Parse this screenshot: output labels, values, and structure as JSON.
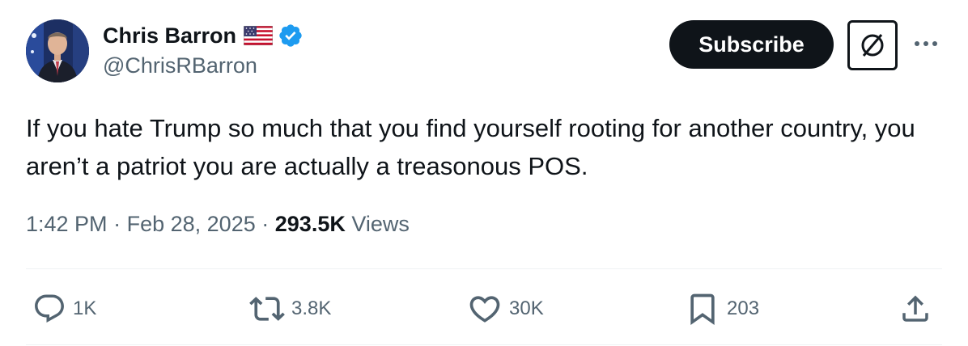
{
  "author": {
    "display_name": "Chris Barron",
    "handle": "@ChrisRBarron",
    "verified": true,
    "avatar_icon": "avatar-photo",
    "flag_icon": "us-flag-icon"
  },
  "header": {
    "subscribe_label": "Subscribe",
    "grok_icon": "grok-icon",
    "more_icon": "more-dots-icon"
  },
  "tweet": {
    "text": "If you hate Trump so much that you find yourself rooting for another country, you aren’t a patriot you are actually a treasonous POS."
  },
  "meta": {
    "time": "1:42 PM",
    "separator": "·",
    "date": "Feb 28, 2025",
    "views_count": "293.5K",
    "views_label": "Views"
  },
  "actions": {
    "replies": "1K",
    "reposts": "3.8K",
    "likes": "30K",
    "bookmarks": "203"
  },
  "colors": {
    "text_primary": "#0f1419",
    "text_secondary": "#536471",
    "verified_blue": "#1d9bf0",
    "divider": "#eff3f4"
  }
}
